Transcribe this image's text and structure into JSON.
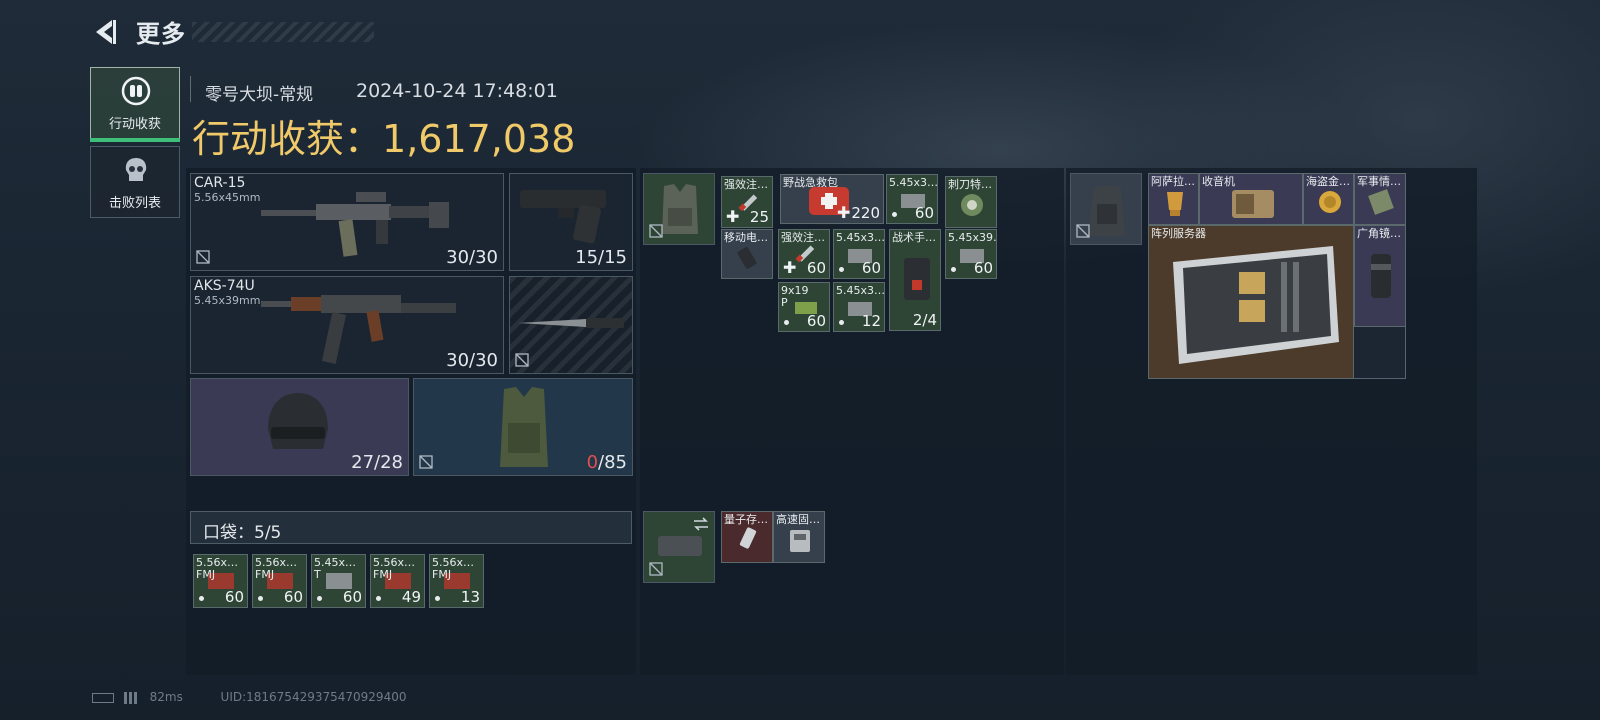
{
  "header": {
    "title": "更多"
  },
  "sidebar": {
    "tabs": [
      {
        "label": "行动收获",
        "active": true
      },
      {
        "label": "击败列表",
        "active": false
      }
    ]
  },
  "match": {
    "map": "零号大坝-常规",
    "datetime": "2024-10-24 17:48:01",
    "haul_label": "行动收获：",
    "haul_value": "1,617,038"
  },
  "loadout": {
    "primary": {
      "name": "CAR-15",
      "caliber": "5.56x45mm",
      "ammo": "30/30"
    },
    "pistol": {
      "ammo": "15/15"
    },
    "secondary": {
      "name": "AKS-74U",
      "caliber": "5.45x39mm",
      "ammo": "30/30"
    },
    "helmet": {
      "durability": "27/28"
    },
    "armor": {
      "durability_current": "0",
      "durability_max": "/85"
    }
  },
  "pocket": {
    "label": "口袋：5/5",
    "items": [
      {
        "name": "5.56x…",
        "sub": "FMJ",
        "count": "60"
      },
      {
        "name": "5.56x…",
        "sub": "FMJ",
        "count": "60"
      },
      {
        "name": "5.45x…",
        "sub": "T",
        "count": "60"
      },
      {
        "name": "5.56x…",
        "sub": "FMJ",
        "count": "49"
      },
      {
        "name": "5.56x…",
        "sub": "FMJ",
        "count": "13"
      }
    ]
  },
  "chest_rig": {
    "items": [
      {
        "name": "强效注…",
        "count": "25"
      },
      {
        "name": "野战急救包",
        "count": "220"
      },
      {
        "name": "5.45x3…",
        "count": "60"
      },
      {
        "name": "刺刀特…",
        "count": ""
      },
      {
        "name": "移动电…",
        "count": ""
      },
      {
        "name": "强效注…",
        "count": "60"
      },
      {
        "name": "5.45x3…",
        "count": "60"
      },
      {
        "name": "战术手…",
        "count": "2/4"
      },
      {
        "name": "5.45x39…",
        "count": "60"
      },
      {
        "name": "9x19",
        "sub": "P",
        "count": "60"
      },
      {
        "name": "5.45x3…",
        "count": "12"
      }
    ]
  },
  "case": {
    "items": [
      {
        "name": "量子存…"
      },
      {
        "name": "高速固…"
      }
    ]
  },
  "backpack": {
    "items": [
      {
        "name": "阿萨拉…"
      },
      {
        "name": "收音机"
      },
      {
        "name": "海盗金…"
      },
      {
        "name": "军事情…"
      },
      {
        "name": "阵列服务器"
      },
      {
        "name": "广角镜…"
      }
    ]
  },
  "status": {
    "ping": "82ms",
    "uid": "UID:1816754293754709294​00"
  }
}
